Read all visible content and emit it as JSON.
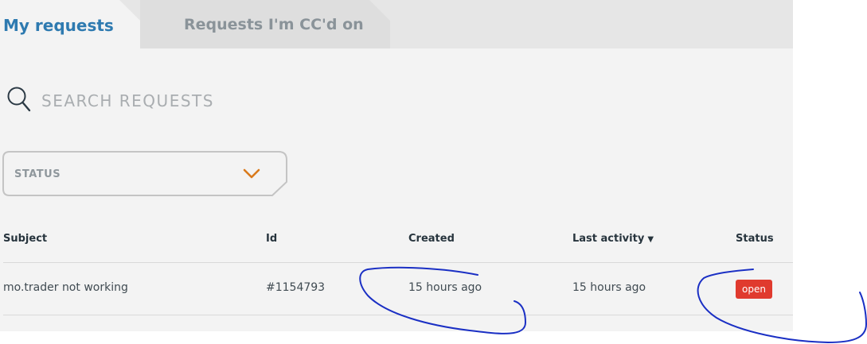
{
  "tabs": [
    {
      "label": "My requests",
      "active": true
    },
    {
      "label": "Requests I'm CC'd on",
      "active": false
    }
  ],
  "search": {
    "placeholder": "SEARCH REQUESTS",
    "value": ""
  },
  "filter": {
    "label": "STATUS"
  },
  "table": {
    "columns": [
      "Subject",
      "Id",
      "Created",
      "Last activity",
      "Status"
    ],
    "sort_indicator": "▼",
    "rows": [
      {
        "subject": "mo.trader not working",
        "id": "#1154793",
        "created": "15 hours ago",
        "last_activity": "15 hours ago",
        "status": "open"
      }
    ]
  },
  "colors": {
    "accent": "#2e7ab0",
    "chevron": "#d97a1c",
    "status_open": "#e03a2e",
    "annotation": "#1a2fc4"
  }
}
